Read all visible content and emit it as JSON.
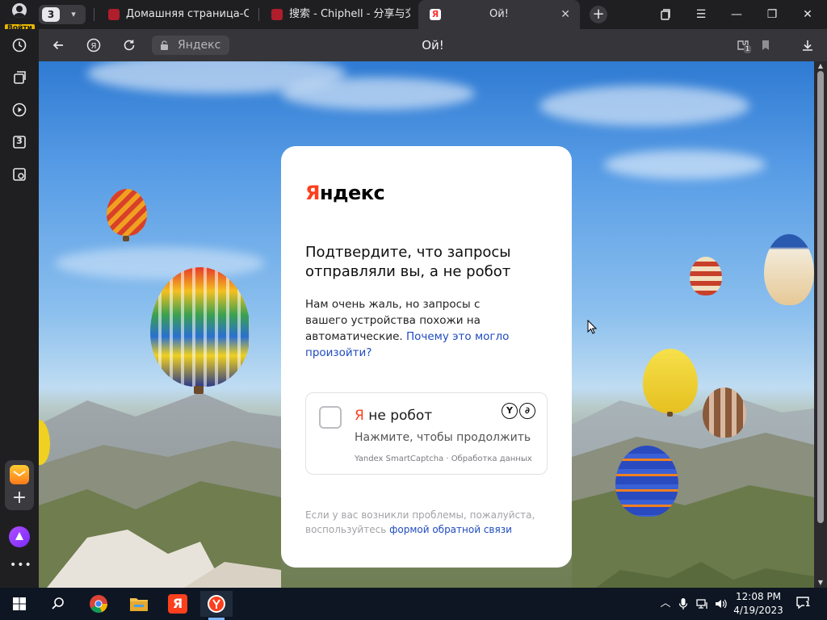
{
  "browser": {
    "profile_label": "Войти",
    "tab_group_count": "3",
    "tabs": [
      {
        "title": "Домашняя страница-Chip",
        "favicon": "chiphell-icon"
      },
      {
        "title": "搜索 - Chiphell - 分享与交",
        "favicon": "chiphell-icon"
      },
      {
        "title": "Ой!",
        "favicon": "yandex-icon",
        "active": true
      }
    ],
    "address_text": "Яндекс",
    "page_title": "Ой!",
    "sidebar_badge": "3",
    "extension_badge": "1"
  },
  "captcha_page": {
    "logo_ya": "Я",
    "logo_rest": "ндекс",
    "heading": "Подтвердите, что запросы отправляли вы, а не робот",
    "description": "Нам очень жаль, но запросы с вашего устройства похожи на автоматические.",
    "why_link": "Почему это могло произойти?",
    "checkbox_ya": "Я",
    "checkbox_label": " не робот",
    "checkbox_hint": "Нажмите, чтобы продолжить",
    "legal_text": "Yandex SmartCaptcha · Обработка данных",
    "footer_text": "Если у вас возникли проблемы, пожалуйста, воспользуйтесь",
    "footer_link": "формой обратной связи"
  },
  "taskbar": {
    "time": "12:08 PM",
    "date": "4/19/2023",
    "notification_count": "1"
  },
  "colors": {
    "yandex_red": "#fc3f1d",
    "link_blue": "#1f4bbf",
    "chrome_dark": "#1f1f22",
    "toolbar": "#35353a"
  }
}
